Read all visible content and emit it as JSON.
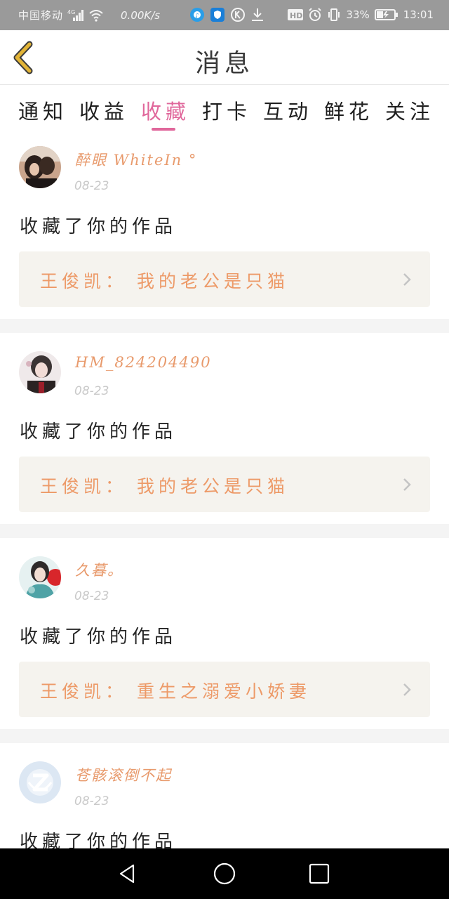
{
  "status_bar": {
    "carrier": "中国移动",
    "network": "4G",
    "speed": "0.00K/s",
    "hd": "HD",
    "battery": "33%",
    "time": "13:01"
  },
  "header": {
    "title": "消息"
  },
  "tabs": [
    {
      "label": "通知",
      "active": false
    },
    {
      "label": "收益",
      "active": false
    },
    {
      "label": "收藏",
      "active": true
    },
    {
      "label": "打卡",
      "active": false
    },
    {
      "label": "互动",
      "active": false
    },
    {
      "label": "鲜花",
      "active": false
    },
    {
      "label": "关注",
      "active": false
    }
  ],
  "notifications": [
    {
      "username": "醉眼 WhiteIn °",
      "date": "08-23",
      "action": "收藏了你的作品",
      "work": "王俊凯： 我的老公是只猫",
      "avatar": "user-avatar-photo"
    },
    {
      "username": "HM_824204490",
      "date": "08-23",
      "action": "收藏了你的作品",
      "work": "王俊凯： 我的老公是只猫",
      "avatar": "user-avatar-photo"
    },
    {
      "username": "久暮。",
      "date": "08-23",
      "action": "收藏了你的作品",
      "work": "王俊凯： 重生之溺爱小娇妻",
      "avatar": "user-avatar-photo"
    },
    {
      "username": "苍骸滚倒不起",
      "date": "08-23",
      "action": "收藏了你的作品",
      "avatar": "default-qzone-avatar"
    }
  ],
  "colors": {
    "accent": "#e0679b",
    "username": "#e89a6c",
    "work_text": "#ed9a68",
    "work_bg": "#f5f3ee",
    "back_arrow": "#e2b437"
  }
}
